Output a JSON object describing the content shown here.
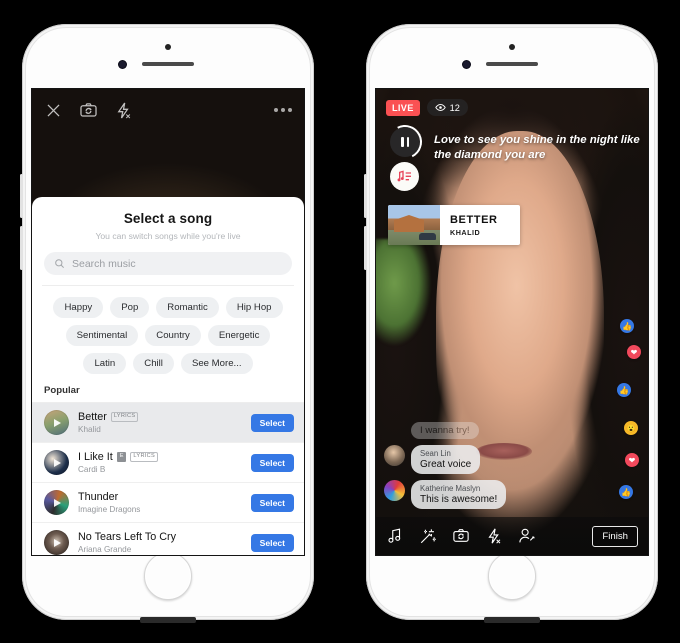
{
  "left_phone": {
    "camera_topbar": {
      "close_label": "×",
      "icons": [
        "close-icon",
        "camera-flip-icon",
        "flash-off-icon",
        "more-options-icon"
      ]
    },
    "sheet": {
      "title": "Select a song",
      "subtitle": "You can switch songs while you're live",
      "search_placeholder": "Search music",
      "mood_chips": [
        "Happy",
        "Pop",
        "Romantic",
        "Hip Hop",
        "Sentimental",
        "Country",
        "Energetic",
        "Latin",
        "Chill",
        "See More..."
      ],
      "section_title": "Popular",
      "select_label": "Select",
      "songs": [
        {
          "title": "Better",
          "artist": "Khalid",
          "lyrics_badge": "LYRICS",
          "explicit": "",
          "selected": true
        },
        {
          "title": "I Like It",
          "artist": "Cardi B",
          "lyrics_badge": "LYRICS",
          "explicit": "E",
          "selected": false
        },
        {
          "title": "Thunder",
          "artist": "Imagine Dragons",
          "lyrics_badge": "",
          "explicit": "",
          "selected": false
        },
        {
          "title": "No Tears Left To Cry",
          "artist": "Ariana Grande",
          "lyrics_badge": "",
          "explicit": "",
          "selected": false
        }
      ]
    }
  },
  "right_phone": {
    "live_badge": "LIVE",
    "viewer_count": "12",
    "lyrics": "Love to see you shine in the night like the diamond you are",
    "now_playing": {
      "title": "BETTER",
      "artist": "KHALID"
    },
    "comments": [
      {
        "name": "",
        "text": "I wanna try!",
        "faded": true
      },
      {
        "name": "Sean Lin",
        "text": "Great voice",
        "faded": false
      },
      {
        "name": "Katherine Maslyn",
        "text": "This is awesome!",
        "faded": false
      }
    ],
    "reactions": [
      "like",
      "love",
      "like",
      "wow",
      "love",
      "like"
    ],
    "bottom_toolbar": {
      "icons": [
        "music-note-icon",
        "effects-wand-icon",
        "camera-flip-icon",
        "flash-off-icon",
        "add-person-icon"
      ],
      "finish_label": "Finish"
    }
  },
  "colors": {
    "accent_blue": "#3578e5",
    "live_red": "#fa5153",
    "reaction_yellow": "#f7b928",
    "reaction_red": "#f2495c"
  }
}
